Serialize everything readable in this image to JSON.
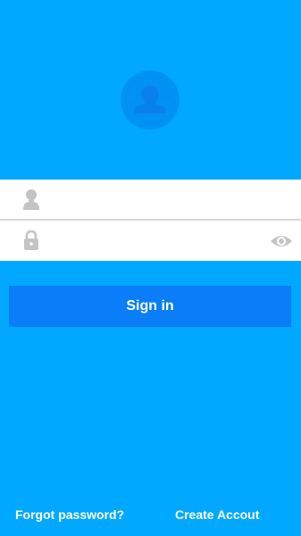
{
  "colors": {
    "background": "#00A8FF",
    "avatar_circle": "#0092F2",
    "avatar_silhouette": "#0A80EE",
    "field_background": "#FFFFFF",
    "field_icon": "#C4C4C4",
    "button": "#0A7DF8",
    "text_light": "#FFFFFF"
  },
  "avatar": {
    "icon": "user-avatar-icon"
  },
  "login_form": {
    "username": {
      "icon": "user-icon",
      "value": "",
      "placeholder": ""
    },
    "password": {
      "icon": "lock-icon",
      "value": "",
      "placeholder": "",
      "toggle_icon": "eye-icon"
    },
    "sign_in_label": "Sign in"
  },
  "footer": {
    "forgot_password_label": "Forgot password?",
    "create_account_label": "Create Accout"
  }
}
